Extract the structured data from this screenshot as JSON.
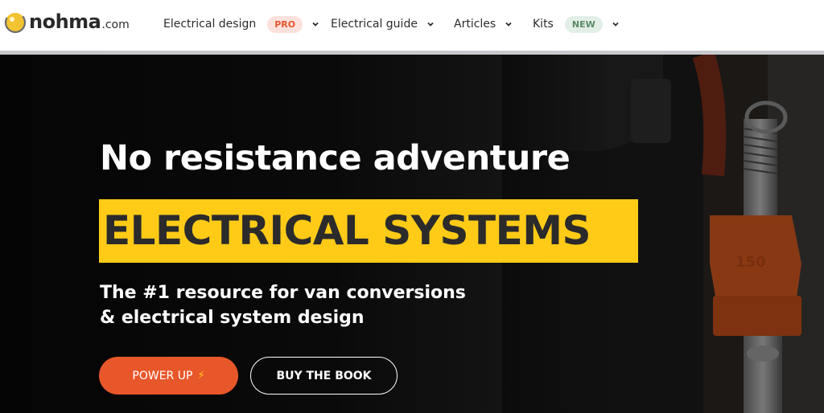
{
  "brand": {
    "name": "nohma",
    "tld": ".com"
  },
  "nav": {
    "items": [
      {
        "label": "Electrical design",
        "badge": "PRO"
      },
      {
        "label": "Electrical guide",
        "badge": null
      },
      {
        "label": "Articles",
        "badge": null
      },
      {
        "label": "Kits",
        "badge": "NEW"
      }
    ]
  },
  "hero": {
    "headline": "No resistance adventure",
    "highlight": "ELECTRICAL SYSTEMS",
    "subline_1": "The #1 resource for van conversions",
    "subline_2": "& electrical system design",
    "primary_button": "POWER UP",
    "primary_button_icon": "⚡",
    "secondary_button": "BUY THE BOOK"
  },
  "colors": {
    "accent_orange": "#e8572a",
    "highlight_yellow": "#ffcb17",
    "badge_pro_text": "#e4572e",
    "badge_new_text": "#5a8a65"
  }
}
